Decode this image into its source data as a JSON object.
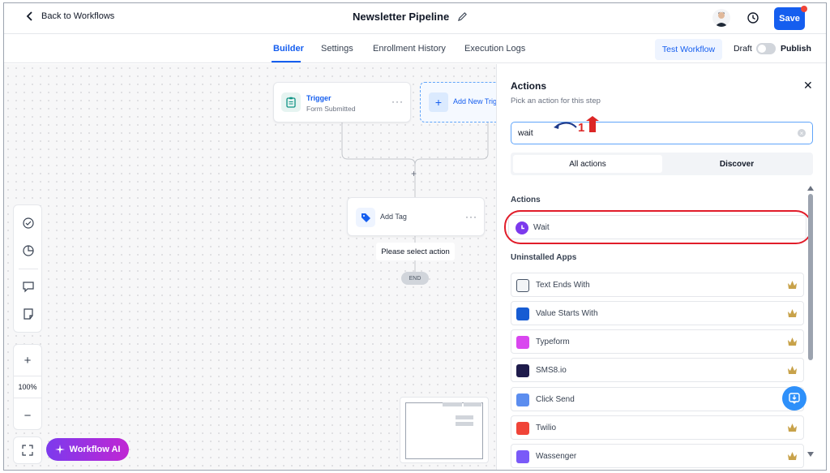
{
  "header": {
    "back_label": "Back to Workflows",
    "title": "Newsletter Pipeline",
    "save_label": "Save"
  },
  "tabs": {
    "items": [
      "Builder",
      "Settings",
      "Enrollment History",
      "Execution Logs"
    ],
    "active": "Builder",
    "test_label": "Test Workflow",
    "draft_label": "Draft",
    "publish_label": "Publish",
    "publish_on": false
  },
  "canvas": {
    "trigger": {
      "title": "Trigger",
      "subtitle": "Form Submitted"
    },
    "add_trigger_label": "Add New Trigger",
    "action_node": {
      "title": "Add Tag"
    },
    "select_action_label": "Please select action",
    "end_label": "END",
    "connector_plus": "+",
    "zoom_level": "100%",
    "ai_button_label": "Workflow AI"
  },
  "panel": {
    "title": "Actions",
    "subtitle": "Pick an action for this step",
    "search_value": "wait",
    "segment_all": "All actions",
    "segment_discover": "Discover",
    "actions_heading": "Actions",
    "actions": [
      {
        "label": "Wait",
        "icon": "clock-icon"
      }
    ],
    "uninstalled_heading": "Uninstalled Apps",
    "apps": [
      {
        "label": "Text Ends With",
        "icon": "document-icon",
        "color": "#475467"
      },
      {
        "label": "Value Starts With",
        "icon": "blue-card-icon",
        "color": "#175cd3"
      },
      {
        "label": "Typeform",
        "icon": "typeform-icon",
        "color": "#c026d3"
      },
      {
        "label": "SMS8.io",
        "icon": "sms8-icon",
        "color": "#1e1b4b"
      },
      {
        "label": "Click Send",
        "icon": "clicksend-icon",
        "color": "#1570ef"
      },
      {
        "label": "Twilio",
        "icon": "twilio-icon",
        "color": "#f04438"
      },
      {
        "label": "Wassenger",
        "icon": "wassenger-icon",
        "color": "#7a5af8"
      }
    ],
    "crown_color": "#c8a24a"
  },
  "annotation": {
    "number": "1"
  },
  "colors": {
    "accent": "#155eef",
    "highlight": "#e11d2a"
  }
}
